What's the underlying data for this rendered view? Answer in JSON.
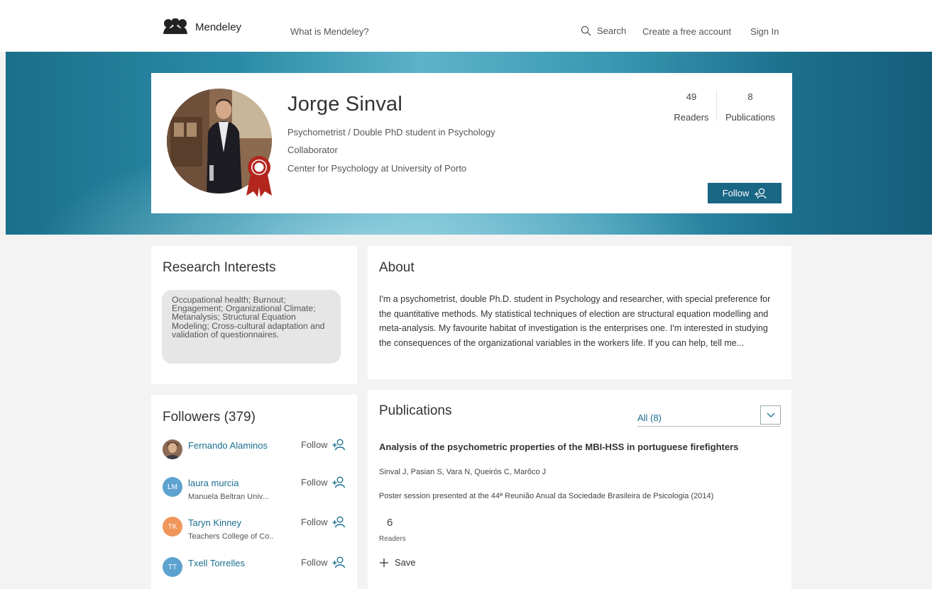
{
  "nav": {
    "brand": "Mendeley",
    "what_is": "What is Mendeley?",
    "search": "Search",
    "create_account": "Create a free account",
    "sign_in": "Sign In"
  },
  "profile": {
    "name": "Jorge Sinval",
    "role": "Psychometrist / Double PhD student in Psychology",
    "status": "Collaborator",
    "institution": "Center for Psychology at University of Porto",
    "readers_count": "49",
    "readers_label": "Readers",
    "publications_count": "8",
    "publications_label": "Publications",
    "follow_label": "Follow"
  },
  "research_interests": {
    "title": "Research Interests",
    "text": "Occupational health; Burnout; Engagement; Organizational Climate; Metanalysis; Structural Equation Modeling; Cross-cultural adaptation and validation of questionnaires."
  },
  "about": {
    "title": "About",
    "text": "I'm a psychometrist, double Ph.D. student in Psychology and researcher, with special preference for the quantitative methods. My statistical techniques of election are structural equation modelling and meta-analysis. My favourite habitat of investigation is the enterprises one. I'm interested in studying the consequences of the organizational variables in the workers life. If you can help, tell me..."
  },
  "followers": {
    "title": "Followers (379)",
    "follow_label": "Follow",
    "items": [
      {
        "name": "Fernando Alaminos",
        "subtitle": "",
        "initials": "",
        "color": "#8a6a55"
      },
      {
        "name": "laura murcia",
        "subtitle": "Manuela Beltran Univ...",
        "initials": "LM",
        "color": "#5ea3cf"
      },
      {
        "name": "Taryn Kinney",
        "subtitle": "Teachers College of Co..",
        "initials": "TK",
        "color": "#f0965a"
      },
      {
        "name": "Txell Torrelles",
        "subtitle": "",
        "initials": "TT",
        "color": "#5ea3cf"
      }
    ]
  },
  "publications": {
    "title": "Publications",
    "filter_value": "All (8)",
    "items": [
      {
        "title": "Analysis of the psychometric properties of the MBI-HSS in portuguese firefighters",
        "authors": "Sinval J, Pasian S, Vara N, Queirós C, Marôco J",
        "venue": "Poster session presented at the 44ª Reunião Anual da Sociedade Brasileira de Psicologia (2014)",
        "readers": "6",
        "readers_label": "Readers",
        "save_label": "Save"
      }
    ]
  },
  "colors": {
    "accent": "#1a6685",
    "link": "#1a6e8f",
    "award": "#b3261e"
  }
}
